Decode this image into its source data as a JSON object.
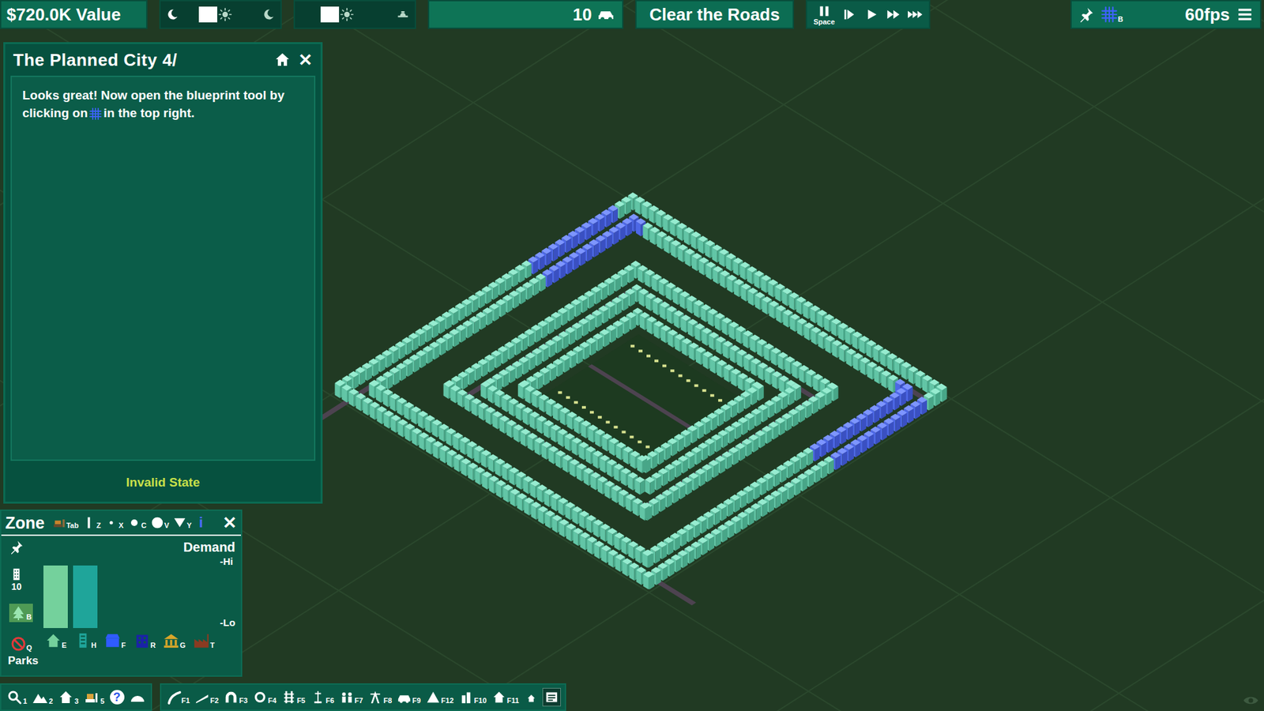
{
  "top_bar": {
    "value": "$720.0K Value",
    "sliders": [
      {
        "kind": "daylight",
        "level": 0.4
      },
      {
        "kind": "weather",
        "level": 0.35
      }
    ],
    "vehicles": "10",
    "goal": "Clear the Roads",
    "speed_buttons": [
      {
        "kind": "pause",
        "key": "Space"
      },
      {
        "kind": "step"
      },
      {
        "kind": "play"
      },
      {
        "kind": "fast"
      },
      {
        "kind": "faster"
      }
    ],
    "blueprint_key": "B",
    "fps": "60fps"
  },
  "tutorial": {
    "title": "The Planned City 4/",
    "close": "✕",
    "text_before": "Looks great! Now open the blueprint tool by clicking on",
    "text_after": "in the top right.",
    "status": "Invalid State"
  },
  "zone_panel": {
    "title": "Zone",
    "close": "✕",
    "tools": [
      {
        "kind": "bulldoze",
        "key": "Tab"
      },
      {
        "kind": "line",
        "key": "Z"
      },
      {
        "kind": "dot-small",
        "key": "X"
      },
      {
        "kind": "dot-medium",
        "key": "C"
      },
      {
        "kind": "dot-large",
        "key": "V"
      },
      {
        "kind": "fill",
        "key": "Y"
      },
      {
        "kind": "info",
        "glyph": "i"
      }
    ],
    "density": "10",
    "side_tools": [
      {
        "kind": "park",
        "key": "B",
        "selected": true
      },
      {
        "kind": "none",
        "key": "Q",
        "selected": false
      }
    ],
    "demand_label": "Demand",
    "high_label": "-Hi",
    "low_label": "-Lo",
    "zones": [
      {
        "key": "E",
        "kind": "house",
        "color": "#74d19c",
        "demand": 0.95
      },
      {
        "key": "H",
        "kind": "tower",
        "color": "#1fa59a",
        "demand": 0.95
      },
      {
        "key": "F",
        "kind": "shop",
        "color": "#2f5bff",
        "demand": 0
      },
      {
        "key": "R",
        "kind": "office",
        "color": "#1b22a8",
        "demand": 0
      },
      {
        "key": "G",
        "kind": "government",
        "color": "#d9a62a",
        "demand": 0
      },
      {
        "key": "T",
        "kind": "factory",
        "color": "#8a3b22",
        "demand": 0
      }
    ],
    "selected_label": "Parks"
  },
  "toolbar_left": [
    {
      "kind": "search",
      "key": "1"
    },
    {
      "kind": "terrain",
      "key": "2"
    },
    {
      "kind": "house",
      "key": "3"
    },
    {
      "kind": "dozer",
      "key": "5"
    },
    {
      "kind": "help",
      "glyph": "?"
    },
    {
      "kind": "dome"
    }
  ],
  "toolbar_right": [
    {
      "kind": "road",
      "key": "F1"
    },
    {
      "kind": "ramp",
      "key": "F2"
    },
    {
      "kind": "tunnel",
      "key": "F3"
    },
    {
      "kind": "loop",
      "key": "F4"
    },
    {
      "kind": "rail",
      "key": "F5"
    },
    {
      "kind": "pylon",
      "key": "F6"
    },
    {
      "kind": "people",
      "key": "F7"
    },
    {
      "kind": "power",
      "key": "F8"
    },
    {
      "kind": "vehicle",
      "key": "F9"
    },
    {
      "kind": "tent",
      "key": "F12"
    },
    {
      "kind": "building",
      "key": "F10"
    },
    {
      "kind": "house",
      "key": "F11"
    },
    {
      "kind": "small-house"
    },
    {
      "kind": "chat"
    }
  ]
}
